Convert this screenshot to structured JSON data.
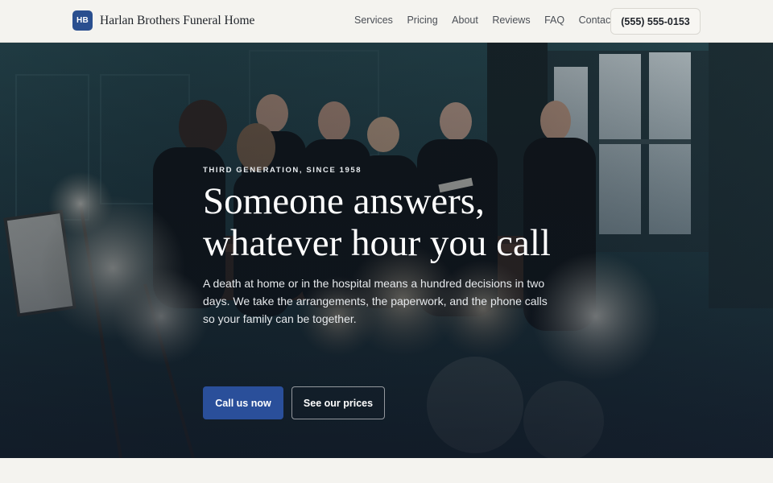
{
  "header": {
    "logo_initials": "HB",
    "brand_name": "Harlan Brothers Funeral Home",
    "nav": [
      {
        "label": "Services"
      },
      {
        "label": "Pricing"
      },
      {
        "label": "About"
      },
      {
        "label": "Reviews"
      },
      {
        "label": "FAQ"
      },
      {
        "label": "Contact"
      }
    ],
    "phone": "(555) 555-0153"
  },
  "hero": {
    "eyebrow": "THIRD GENERATION, SINCE 1958",
    "title": "Someone answers, whatever hour you call",
    "subtitle": "A death at home or in the hospital means a hundred decisions in two days. We take the arrangements, the paperwork, and the phone calls so your family can be together.",
    "primary_cta": "Call us now",
    "secondary_cta": "See our prices",
    "image_subject": "mourners-gathered-around-casket-photo"
  },
  "colors": {
    "accent": "#2a4f9a",
    "logo_badge": "#2a4f8f",
    "page_bg": "#f4f3ef",
    "hero_wall": "#24434a"
  }
}
